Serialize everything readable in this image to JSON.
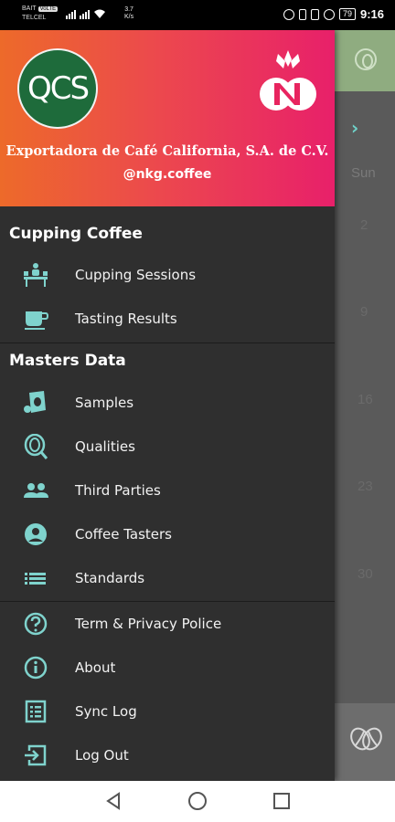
{
  "status_bar": {
    "carrier_line1": "BAIT",
    "carrier_volte": "VoLTE",
    "carrier_line2": "TELCEL",
    "speed_value": "3.7",
    "speed_unit": "K/s",
    "battery": "79",
    "time": "9:16"
  },
  "drawer": {
    "header": {
      "qcs_logo_text": "QCS",
      "company_name": "Exportadora de Café California, S.A. de C.V.",
      "handle": "@nkg.coffee"
    },
    "sections": [
      {
        "title": "Cupping Coffee",
        "items": [
          {
            "label": "Cupping Sessions",
            "icon": "cupping-table-icon"
          },
          {
            "label": "Tasting Results",
            "icon": "coffee-cup-icon"
          }
        ]
      },
      {
        "title": "Masters Data",
        "items": [
          {
            "label": "Samples",
            "icon": "sample-bag-icon"
          },
          {
            "label": "Qualities",
            "icon": "bean-search-icon"
          },
          {
            "label": "Third Parties",
            "icon": "people-icon"
          },
          {
            "label": "Coffee Tasters",
            "icon": "account-circle-icon"
          },
          {
            "label": "Standards",
            "icon": "list-icon"
          }
        ]
      }
    ],
    "footer_items": [
      {
        "label": "Term & Privacy Police",
        "icon": "help-circle-icon"
      },
      {
        "label": "About",
        "icon": "info-circle-icon"
      },
      {
        "label": "Sync Log",
        "icon": "log-list-icon"
      },
      {
        "label": "Log Out",
        "icon": "logout-icon"
      }
    ]
  },
  "background_calendar": {
    "day_label": "Sun",
    "dates": [
      "2",
      "9",
      "16",
      "23",
      "30"
    ]
  },
  "colors": {
    "accent": "#7fd3cd",
    "header_start": "#ed6a2a",
    "header_end": "#e8206a",
    "drawer_bg": "#2f2f2f"
  }
}
